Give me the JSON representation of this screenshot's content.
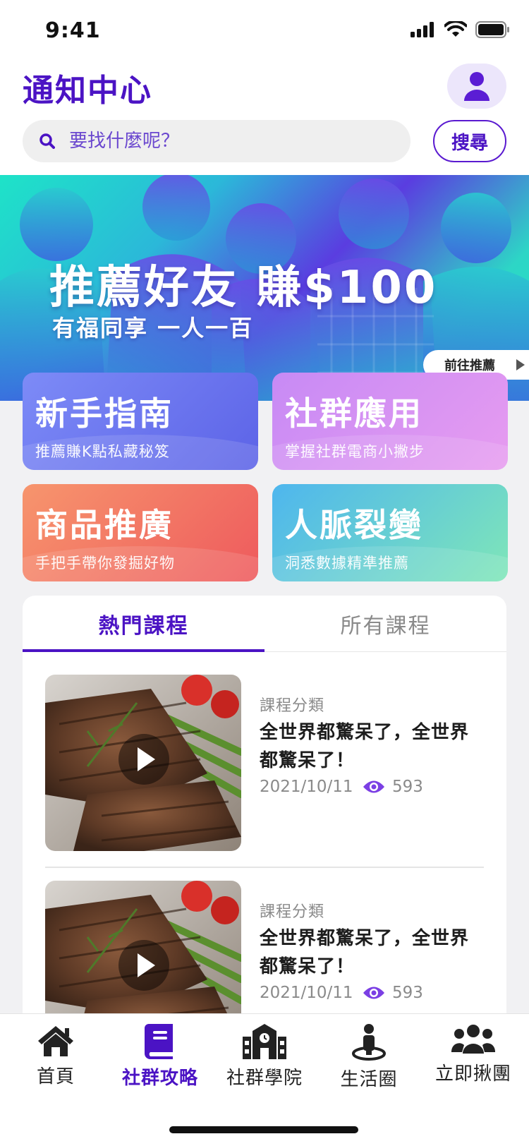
{
  "status_bar": {
    "time": "9:41"
  },
  "header": {
    "title": "通知中心"
  },
  "search": {
    "placeholder": "要找什麼呢？",
    "button_label": "搜尋"
  },
  "banner": {
    "title": "推薦好友 賺$100",
    "subtitle": "有福同享 一人一百",
    "link_label": "前往推薦"
  },
  "cards": [
    {
      "title": "新手指南",
      "subtitle": "推薦賺K點私藏秘笈"
    },
    {
      "title": "社群應用",
      "subtitle": "掌握社群電商小撇步"
    },
    {
      "title": "商品推廣",
      "subtitle": "手把手帶你發掘好物"
    },
    {
      "title": "人脈裂變",
      "subtitle": "洞悉數據精準推薦"
    }
  ],
  "course_tabs": [
    {
      "label": "熱門課程",
      "active": true
    },
    {
      "label": "所有課程",
      "active": false
    }
  ],
  "courses": [
    {
      "category": "課程分類",
      "title": "全世界都驚呆了，全世界都驚呆了！",
      "date": "2021/10/11",
      "views": "593"
    },
    {
      "category": "課程分類",
      "title": "全世界都驚呆了，全世界都驚呆了！",
      "date": "2021/10/11",
      "views": "593"
    }
  ],
  "tabbar": [
    {
      "label": "首頁",
      "icon": "home-icon",
      "active": false
    },
    {
      "label": "社群攻略",
      "icon": "book-icon",
      "active": true
    },
    {
      "label": "社群學院",
      "icon": "school-icon",
      "active": false
    },
    {
      "label": "生活圈",
      "icon": "location-person-icon",
      "active": false
    },
    {
      "label": "立即揪團",
      "icon": "group-icon",
      "active": false
    }
  ],
  "colors": {
    "accent": "#4b13c4",
    "accent_light": "#ece6fb"
  }
}
